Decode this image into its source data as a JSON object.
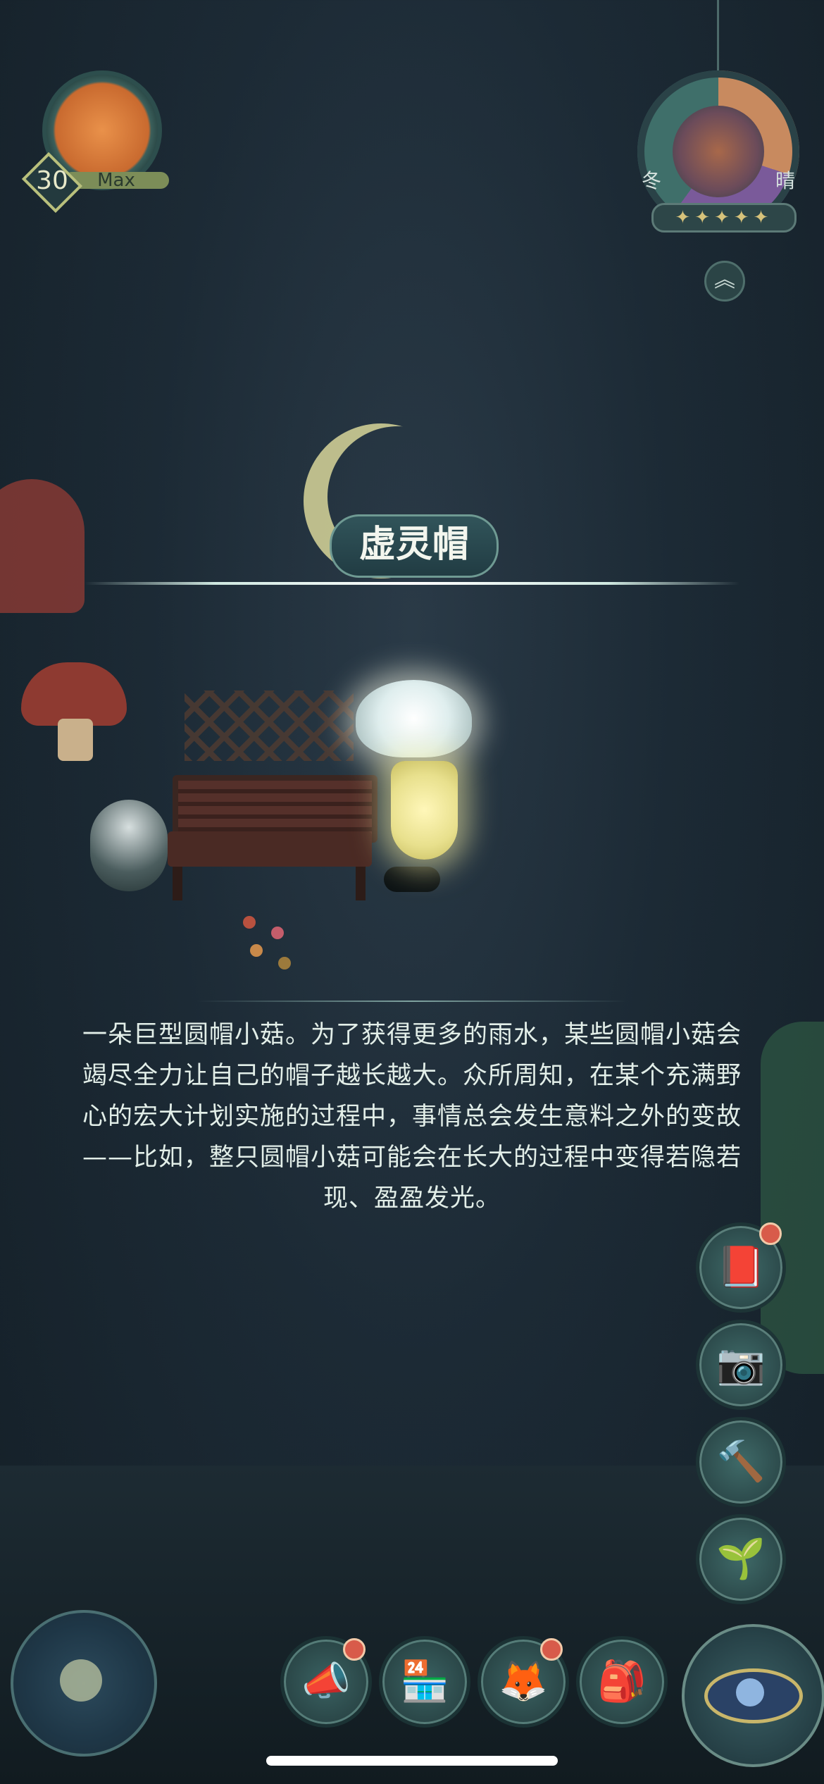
{
  "player": {
    "level": "30",
    "level_label": "Max"
  },
  "season_widget": {
    "left_label": "冬",
    "right_label": "晴",
    "stars": "✦✦✦✦✦"
  },
  "item": {
    "name": "虚灵帽",
    "description": "一朵巨型圆帽小菇。为了获得更多的雨水，某些圆帽小菇会竭尽全力让自己的帽子越长越大。众所周知，在某个充满野心的宏大计划实施的过程中，事情总会发生意料之外的变故——比如，整只圆帽小菇可能会在长大的过程中变得若隐若现、盈盈发光。"
  },
  "side_buttons": [
    {
      "name": "encyclopedia-book-icon",
      "glyph": "📕",
      "badge": true
    },
    {
      "name": "camera-icon",
      "glyph": "📷",
      "badge": false
    },
    {
      "name": "hammer-icon",
      "glyph": "🔨",
      "badge": false
    },
    {
      "name": "sprout-icon",
      "glyph": "🌱",
      "badge": false
    }
  ],
  "bottom_buttons": [
    {
      "name": "megaphone-icon",
      "glyph": "📣",
      "badge": true
    },
    {
      "name": "shop-icon",
      "glyph": "🏪",
      "badge": false
    },
    {
      "name": "fox-icon",
      "glyph": "🦊",
      "badge": true
    },
    {
      "name": "backpack-icon",
      "glyph": "🎒",
      "badge": false
    }
  ],
  "expand_glyph": "︽",
  "colors": {
    "background": "#1c2a35",
    "accent_teal": "#6f9a93",
    "badge_red": "#d85b4a",
    "glow_yellow": "#fff7b9"
  }
}
